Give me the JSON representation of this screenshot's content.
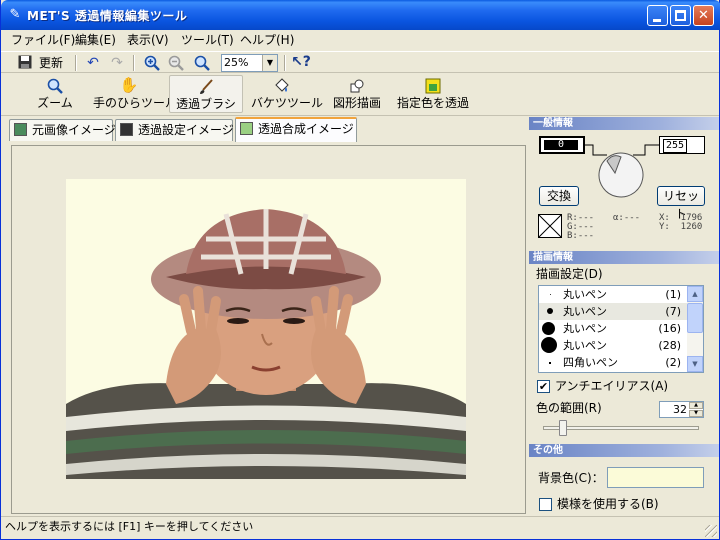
{
  "window": {
    "title": "MET'S 透過情報編集ツール"
  },
  "menu": [
    "ファイル(F)",
    "編集(E)",
    "表示(V)",
    "ツール(T)",
    "ヘルプ(H)"
  ],
  "toolbar": {
    "refresh_label": "更新",
    "zoom_value": "25%"
  },
  "tools": [
    {
      "label": "ズーム",
      "icon": "magnifier-icon"
    },
    {
      "label": "手のひらツール",
      "icon": "hand-icon"
    },
    {
      "label": "透過ブラシ",
      "icon": "brush-icon",
      "active": true
    },
    {
      "label": "バケツツール",
      "icon": "bucket-icon"
    },
    {
      "label": "図形描画",
      "icon": "shape-icon"
    },
    {
      "label": "指定色を透過",
      "icon": "color-picker-icon"
    }
  ],
  "tabs": [
    {
      "label": "元画像イメージ"
    },
    {
      "label": "透過設定イメージ"
    },
    {
      "label": "透過合成イメージ",
      "active": true
    }
  ],
  "general": {
    "header": "一般情報",
    "left_value": "0",
    "right_value": "255",
    "swap_label": "交換",
    "reset_label": "リセット",
    "rgb_text": "R:---\nG:---\nB:---",
    "alpha_text": "α:---",
    "coords_text": "X:  1796\nY:  1260"
  },
  "drawing": {
    "header": "描画情報",
    "setting_label": "描画設定(D)",
    "pens": [
      {
        "name": "丸いペン",
        "size": "(1)",
        "dot": 1
      },
      {
        "name": "丸いペン",
        "size": "(7)",
        "dot": 6,
        "selected": true
      },
      {
        "name": "丸いペン",
        "size": "(16)",
        "dot": 13
      },
      {
        "name": "丸いペン",
        "size": "(28)",
        "dot": 16
      },
      {
        "name": "四角いペン",
        "size": "(2)",
        "dot": 2
      }
    ],
    "antialias_label": "アンチエイリアス(A)",
    "antialias_checked": "✔",
    "color_range_label": "色の範囲(R)",
    "color_range_value": "32"
  },
  "other": {
    "header": "その他",
    "bg_color_label": "背景色(C)：",
    "bg_color": "#fbfbd8",
    "pattern_label": "模様を使用する(B)"
  },
  "status": {
    "text": "ヘルプを表示するには [F1] キーを押してください"
  },
  "colors": {
    "image_bg": "#fcfce3",
    "title_blue": "#0a55e0"
  }
}
